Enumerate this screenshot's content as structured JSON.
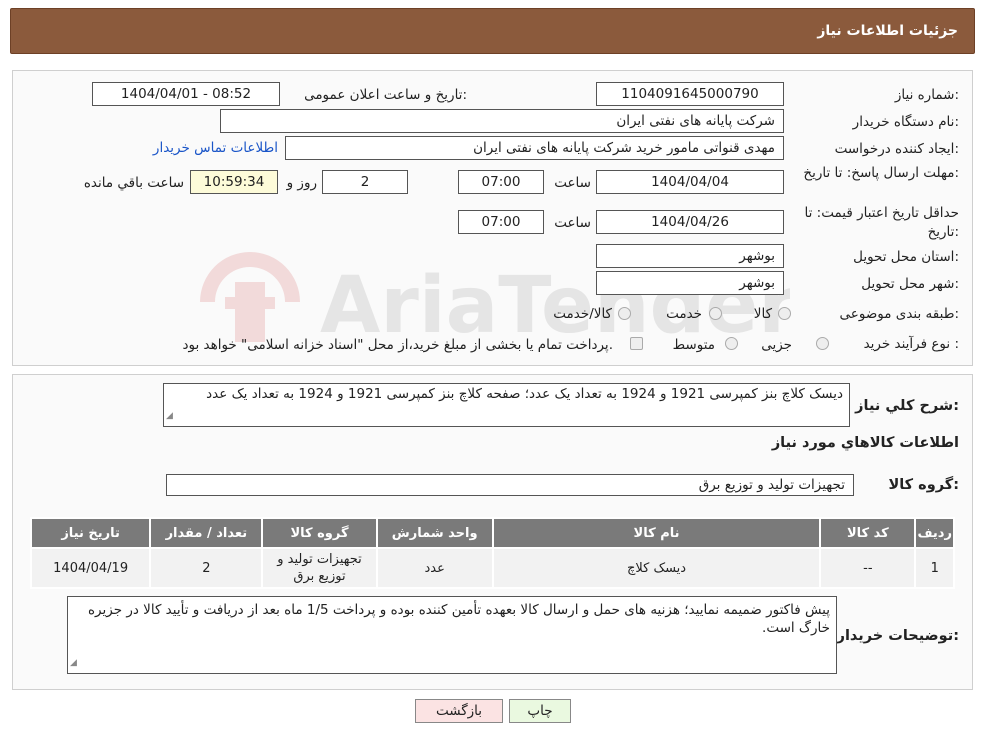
{
  "header": {
    "title": "جزئیات اطلاعات نیاز"
  },
  "form": {
    "need_number_label": "شماره نیاز:",
    "need_number": "1104091645000790",
    "announce_label": "تاریخ و ساعت اعلان عمومی:",
    "announce_value": "1404/04/01 - 08:52",
    "buyer_org_label": "نام دستگاه خریدار:",
    "buyer_org": "شرکت پایانه های نفتی ایران",
    "requester_label": "ایجاد کننده درخواست:",
    "requester": "مهدی قنواتی مامور خرید شرکت پایانه های نفتی ایران",
    "contact_link": "اطلاعات تماس خریدار",
    "reply_deadline_label": "مهلت ارسال پاسخ: تا تاریخ:",
    "reply_date": "1404/04/04",
    "time_label": "ساعت",
    "reply_time": "07:00",
    "days": "2",
    "days_label": "روز و",
    "remaining_time": "10:59:34",
    "remaining_label": "ساعت باقي مانده",
    "validity_label": "حداقل تاریخ اعتبار قیمت: تا تاریخ:",
    "validity_date": "1404/04/26",
    "validity_time": "07:00",
    "province_label": "استان محل تحویل:",
    "province": "بوشهر",
    "city_label": "شهر محل تحویل:",
    "city": "بوشهر",
    "category_label": "طبقه بندی موضوعی:",
    "category_options": [
      "کالا",
      "خدمت",
      "کالا/خدمت"
    ],
    "purchase_type_label": "نوع فرآیند خرید :",
    "purchase_options": [
      "جزیی",
      "متوسط"
    ],
    "purchase_note": "پرداخت تمام یا بخشی از مبلغ خرید،از محل \"اسناد خزانه اسلامی\" خواهد بود."
  },
  "summary": {
    "label": "شرح کلي نیاز:",
    "text": "دیسک کلاچ بنز کمپرسی 1921 و 1924 به تعداد یک عدد؛ صفحه کلاچ بنز کمپرسی 1921 و 1924 به تعداد یک عدد"
  },
  "goods": {
    "section_title": "اطلاعات کالاهاي مورد نیاز",
    "group_label": "گروه کالا:",
    "group_value": "تجهیزات تولید و توزیع برق",
    "columns": [
      "ردیف",
      "کد کالا",
      "نام کالا",
      "واحد شمارش",
      "گروه کالا",
      "تعداد / مقدار",
      "تاریخ نیاز"
    ],
    "rows": [
      [
        "1",
        "--",
        "دیسک کلاچ",
        "عدد",
        "تجهیزات تولید و توزیع برق",
        "2",
        "1404/04/19"
      ]
    ]
  },
  "buyer_notes": {
    "label": "توضیحات خریدار:",
    "text": "پیش فاکتور ضمیمه نمایید؛ هزنیه های حمل و ارسال کالا بعهده تأمین کننده بوده و پرداخت 1/5 ماه بعد از دریافت و تأیید کالا در جزیره خارگ است."
  },
  "buttons": {
    "print": "چاپ",
    "back": "بازگشت"
  },
  "watermark": {
    "text": "AriaTender.neT"
  },
  "colors": {
    "header": "#8b5a3c",
    "link": "#1a55c8",
    "table_header": "#7a7a7a",
    "remaining_bg": "#fdfbd9",
    "print_btn": "#eaf9e0",
    "back_btn": "#fbe3e3"
  }
}
